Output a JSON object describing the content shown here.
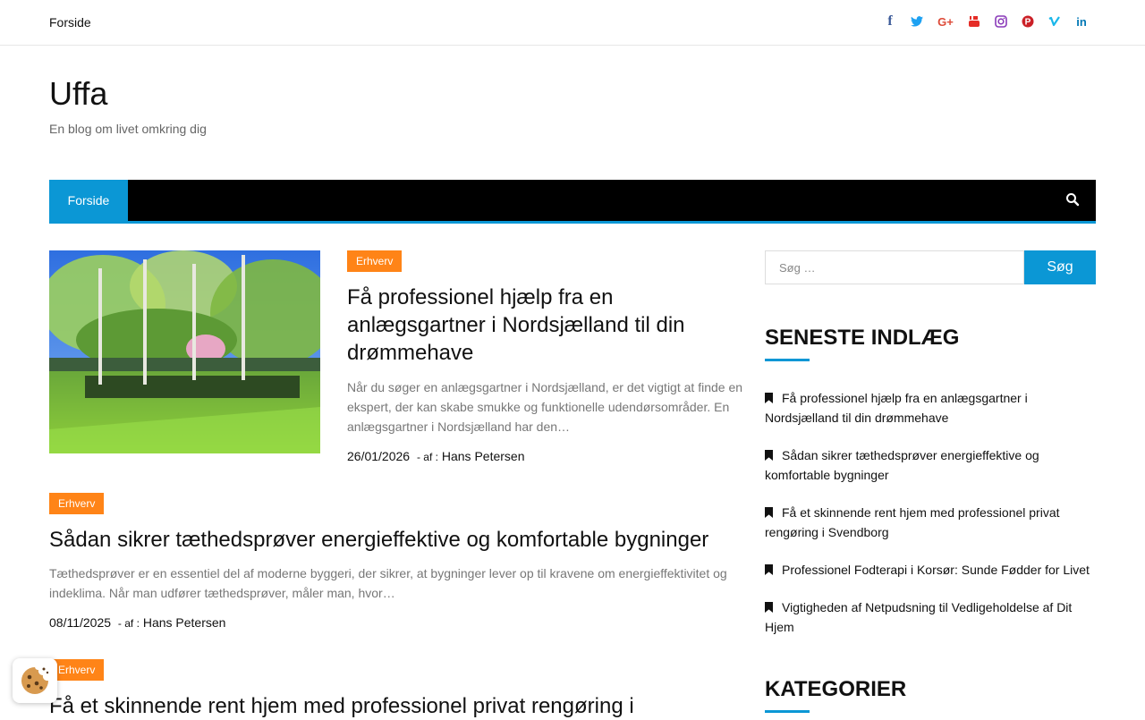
{
  "topbar": {
    "home_link": "Forside",
    "social_icons": [
      {
        "name": "facebook-icon",
        "glyph": "f",
        "color": "#3b5998"
      },
      {
        "name": "twitter-icon",
        "glyph": "t",
        "color": "#1da1f2"
      },
      {
        "name": "google-plus-icon",
        "glyph": "G+",
        "color": "#dd4b39"
      },
      {
        "name": "youtube-icon",
        "glyph": "▶",
        "color": "#e52d27"
      },
      {
        "name": "instagram-icon",
        "glyph": "◎",
        "color": "#8a3ab9"
      },
      {
        "name": "pinterest-icon",
        "glyph": "P",
        "color": "#cb2027"
      },
      {
        "name": "vimeo-icon",
        "glyph": "v",
        "color": "#1ab7ea"
      },
      {
        "name": "linkedin-icon",
        "glyph": "in",
        "color": "#0077b5"
      }
    ]
  },
  "site": {
    "title": "Uffa",
    "description": "En blog om livet omkring dig"
  },
  "nav": {
    "items": [
      "Forside"
    ],
    "search_icon": "search-icon"
  },
  "posts": [
    {
      "category": "Erhverv",
      "title": "Få professionel hjælp fra en anlægsgartner i Nordsjælland til din drømmehave",
      "excerpt": "Når du søger en anlægsgartner i Nordsjælland, er det vigtigt at finde en ekspert, der kan skabe smukke og funktionelle udendørsområder. En anlægsgartner i Nordsjælland har den…",
      "date": "26/01/2026",
      "by_label": "- af :",
      "author": "Hans Petersen"
    },
    {
      "category": "Erhverv",
      "title": "Sådan sikrer tæthedsprøver energieffektive og komfortable bygninger",
      "excerpt": "Tæthedsprøver er en essentiel del af moderne byggeri, der sikrer, at bygninger lever op til kravene om energieffektivitet og indeklima. Når man udfører tæthedsprøver, måler man, hvor…",
      "date": "08/11/2025",
      "by_label": "- af :",
      "author": "Hans Petersen"
    },
    {
      "category": "Erhverv",
      "title": "Få et skinnende rent hjem med professionel privat rengøring i"
    }
  ],
  "sidebar": {
    "search_placeholder": "Søg …",
    "search_button": "Søg",
    "recent_title": "SENESTE INDLÆG",
    "recent_posts": [
      "Få professionel hjælp fra en anlægsgartner i Nordsjælland til din drømmehave",
      "Sådan sikrer tæthedsprøver energieffektive og komfortable bygninger",
      "Få et skinnende rent hjem med professionel privat rengøring i Svendborg",
      "Professionel Fodterapi i Korsør: Sunde Fødder for Livet",
      "Vigtigheden af Netpudsning til Vedligeholdelse af Dit Hjem"
    ],
    "categories_title": "KATEGORIER"
  },
  "colors": {
    "accent": "#0b97d5",
    "category_badge": "#ff8417",
    "nav_background": "#000000"
  }
}
